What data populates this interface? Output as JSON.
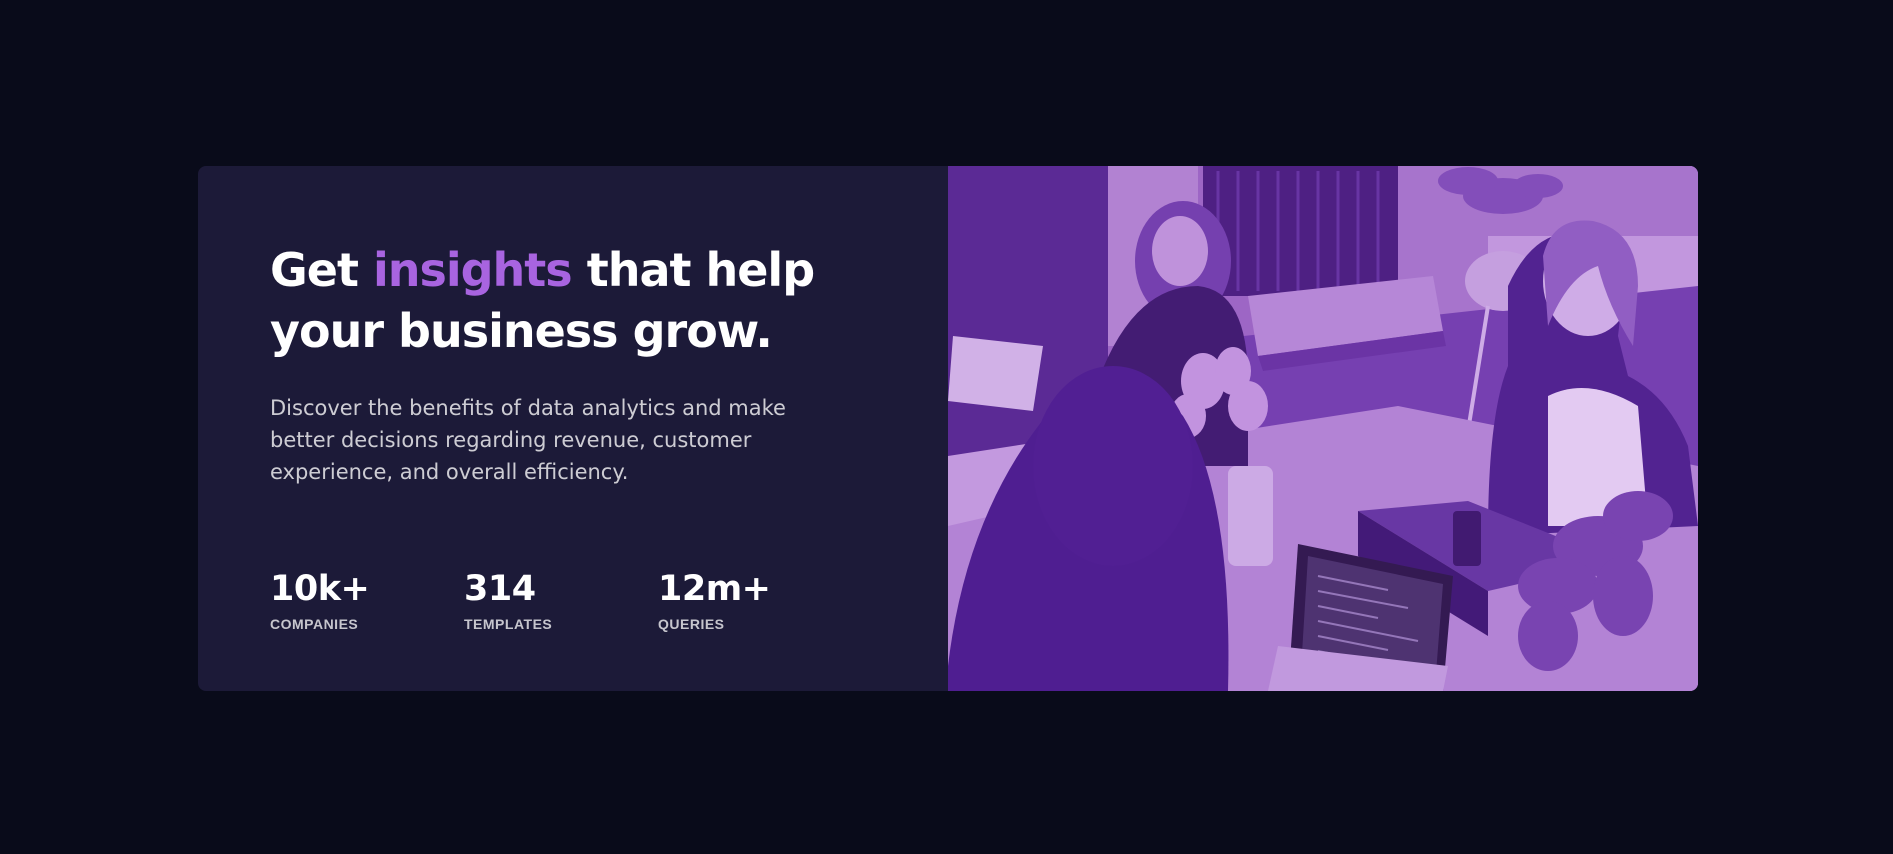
{
  "headline": {
    "part1": "Get ",
    "accent": "insights",
    "part2": " that help your business grow."
  },
  "description": "Discover the benefits of data analytics and make better decisions regarding revenue, customer experience, and overall efficiency.",
  "stats": [
    {
      "value": "10k+",
      "label": "COMPANIES"
    },
    {
      "value": "314",
      "label": "TEMPLATES"
    },
    {
      "value": "12m+",
      "label": "QUERIES"
    }
  ],
  "image": {
    "subject": "team-meeting-photo"
  },
  "colors": {
    "page_background": "#090b1a",
    "card_background": "#1c1a38",
    "accent": "#a864e0",
    "image_overlay": "#aa5cdb"
  }
}
